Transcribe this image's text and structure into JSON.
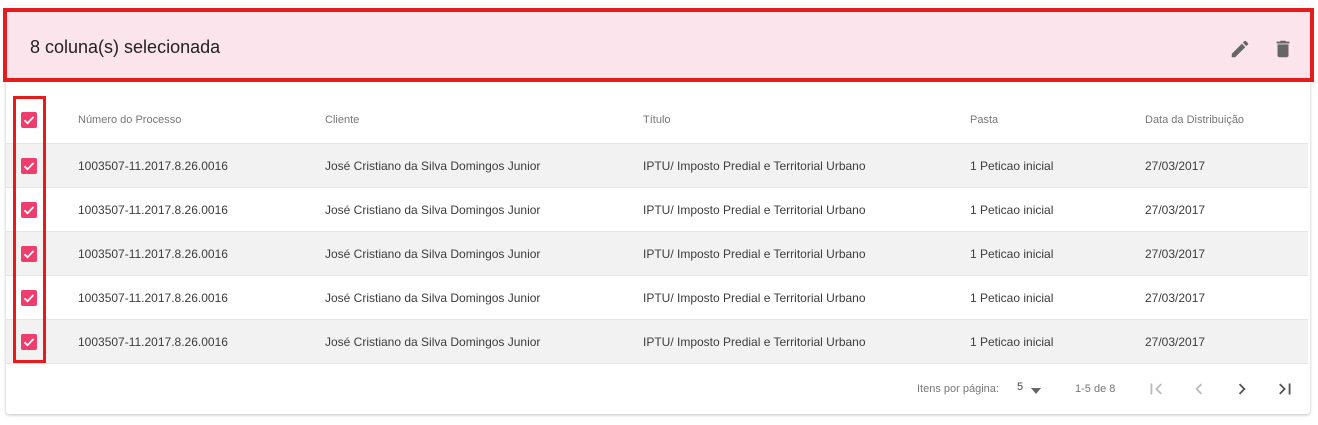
{
  "toolbar": {
    "title": "8 coluna(s) selecionada",
    "edit_icon": "edit-icon",
    "delete_icon": "delete-icon"
  },
  "table": {
    "headers": {
      "numero": "Número do Processo",
      "cliente": "Cliente",
      "titulo": "Título",
      "pasta": "Pasta",
      "data": "Data da Distribuição"
    },
    "rows": [
      {
        "numero": "1003507-11.2017.8.26.0016",
        "cliente": "José Cristiano da Silva Domingos Junior",
        "titulo": "IPTU/ Imposto Predial e Territorial Urbano",
        "pasta": "1 Peticao inicial",
        "data": "27/03/2017"
      },
      {
        "numero": "1003507-11.2017.8.26.0016",
        "cliente": "José Cristiano da Silva Domingos Junior",
        "titulo": "IPTU/ Imposto Predial e Territorial Urbano",
        "pasta": "1 Peticao inicial",
        "data": "27/03/2017"
      },
      {
        "numero": "1003507-11.2017.8.26.0016",
        "cliente": "José Cristiano da Silva Domingos Junior",
        "titulo": "IPTU/ Imposto Predial e Territorial Urbano",
        "pasta": "1 Peticao inicial",
        "data": "27/03/2017"
      },
      {
        "numero": "1003507-11.2017.8.26.0016",
        "cliente": "José Cristiano da Silva Domingos Junior",
        "titulo": "IPTU/ Imposto Predial e Territorial Urbano",
        "pasta": "1 Peticao inicial",
        "data": "27/03/2017"
      },
      {
        "numero": "1003507-11.2017.8.26.0016",
        "cliente": "José Cristiano da Silva Domingos Junior",
        "titulo": "IPTU/ Imposto Predial e Territorial Urbano",
        "pasta": "1 Peticao inicial",
        "data": "27/03/2017"
      }
    ]
  },
  "paginator": {
    "items_label": "Itens por página:",
    "page_size": "5",
    "range": "1-5 de 8"
  },
  "colors": {
    "accent": "#ef3d6e",
    "toolbar_bg": "#fce4ec",
    "highlight_border": "#e41c1c"
  }
}
